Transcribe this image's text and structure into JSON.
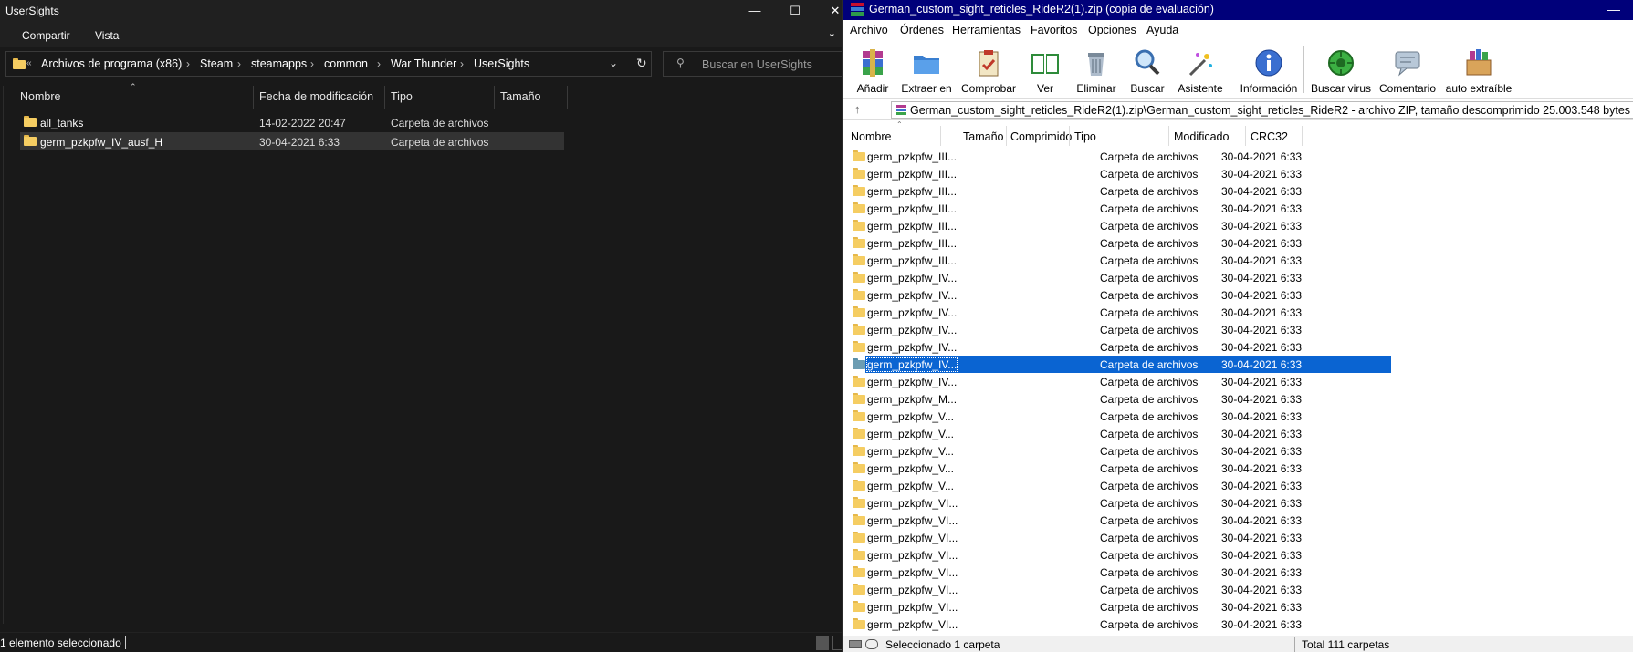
{
  "explorer": {
    "title": "UserSights",
    "window_buttons": [
      "—",
      "☐",
      "✕"
    ],
    "ribbon": {
      "share": "Compartir",
      "view": "Vista"
    },
    "breadcrumb": [
      "Archivos de programa (x86)",
      "Steam",
      "steamapps",
      "common",
      "War Thunder",
      "UserSights"
    ],
    "search_placeholder": "Buscar en UserSights",
    "columns": [
      "Nombre",
      "Fecha de modificación",
      "Tipo",
      "Tamaño"
    ],
    "rows": [
      {
        "name": "all_tanks",
        "date": "14-02-2022 20:47",
        "type": "Carpeta de archivos",
        "selected": false
      },
      {
        "name": "germ_pzkpfw_IV_ausf_H",
        "date": "30-04-2021 6:33",
        "type": "Carpeta de archivos",
        "selected": true
      }
    ],
    "status": "1 elemento seleccionado"
  },
  "winrar": {
    "title": "German_custom_sight_reticles_RideR2(1).zip (copia de evaluación)",
    "menu": [
      "Archivo",
      "Órdenes",
      "Herramientas",
      "Favoritos",
      "Opciones",
      "Ayuda"
    ],
    "toolbar": [
      {
        "label": "Añadir",
        "icon": "add-archive-icon"
      },
      {
        "label": "Extraer en",
        "icon": "extract-folder-icon"
      },
      {
        "label": "Comprobar",
        "icon": "test-clipboard-icon"
      },
      {
        "label": "Ver",
        "icon": "view-book-icon"
      },
      {
        "label": "Eliminar",
        "icon": "delete-trash-icon"
      },
      {
        "label": "Buscar",
        "icon": "find-magnifier-icon"
      },
      {
        "label": "Asistente",
        "icon": "wizard-wand-icon"
      },
      {
        "label": "Información",
        "icon": "info-icon"
      },
      {
        "label": "Buscar virus",
        "icon": "virus-scan-icon"
      },
      {
        "label": "Comentario",
        "icon": "comment-icon"
      },
      {
        "label": "auto extraíble",
        "icon": "sfx-box-icon"
      }
    ],
    "path": "German_custom_sight_reticles_RideR2(1).zip\\German_custom_sight_reticles_RideR2 - archivo ZIP, tamaño descomprimido 25.003.548 bytes",
    "columns": [
      "Nombre",
      "Tamaño",
      "Comprimido",
      "Tipo",
      "Modificado",
      "CRC32"
    ],
    "rows": [
      {
        "name": "germ_pzkpfw_III...",
        "type": "Carpeta de archivos",
        "modified": "30-04-2021 6:33"
      },
      {
        "name": "germ_pzkpfw_III...",
        "type": "Carpeta de archivos",
        "modified": "30-04-2021 6:33"
      },
      {
        "name": "germ_pzkpfw_III...",
        "type": "Carpeta de archivos",
        "modified": "30-04-2021 6:33"
      },
      {
        "name": "germ_pzkpfw_III...",
        "type": "Carpeta de archivos",
        "modified": "30-04-2021 6:33"
      },
      {
        "name": "germ_pzkpfw_III...",
        "type": "Carpeta de archivos",
        "modified": "30-04-2021 6:33"
      },
      {
        "name": "germ_pzkpfw_III...",
        "type": "Carpeta de archivos",
        "modified": "30-04-2021 6:33"
      },
      {
        "name": "germ_pzkpfw_III...",
        "type": "Carpeta de archivos",
        "modified": "30-04-2021 6:33"
      },
      {
        "name": "germ_pzkpfw_IV...",
        "type": "Carpeta de archivos",
        "modified": "30-04-2021 6:33"
      },
      {
        "name": "germ_pzkpfw_IV...",
        "type": "Carpeta de archivos",
        "modified": "30-04-2021 6:33"
      },
      {
        "name": "germ_pzkpfw_IV...",
        "type": "Carpeta de archivos",
        "modified": "30-04-2021 6:33"
      },
      {
        "name": "germ_pzkpfw_IV...",
        "type": "Carpeta de archivos",
        "modified": "30-04-2021 6:33"
      },
      {
        "name": "germ_pzkpfw_IV...",
        "type": "Carpeta de archivos",
        "modified": "30-04-2021 6:33"
      },
      {
        "name": "germ_pzkpfw_IV...",
        "type": "Carpeta de archivos",
        "modified": "30-04-2021 6:33",
        "selected": true
      },
      {
        "name": "germ_pzkpfw_IV...",
        "type": "Carpeta de archivos",
        "modified": "30-04-2021 6:33"
      },
      {
        "name": "germ_pzkpfw_M...",
        "type": "Carpeta de archivos",
        "modified": "30-04-2021 6:33"
      },
      {
        "name": "germ_pzkpfw_V...",
        "type": "Carpeta de archivos",
        "modified": "30-04-2021 6:33"
      },
      {
        "name": "germ_pzkpfw_V...",
        "type": "Carpeta de archivos",
        "modified": "30-04-2021 6:33"
      },
      {
        "name": "germ_pzkpfw_V...",
        "type": "Carpeta de archivos",
        "modified": "30-04-2021 6:33"
      },
      {
        "name": "germ_pzkpfw_V...",
        "type": "Carpeta de archivos",
        "modified": "30-04-2021 6:33"
      },
      {
        "name": "germ_pzkpfw_V...",
        "type": "Carpeta de archivos",
        "modified": "30-04-2021 6:33"
      },
      {
        "name": "germ_pzkpfw_VI...",
        "type": "Carpeta de archivos",
        "modified": "30-04-2021 6:33"
      },
      {
        "name": "germ_pzkpfw_VI...",
        "type": "Carpeta de archivos",
        "modified": "30-04-2021 6:33"
      },
      {
        "name": "germ_pzkpfw_VI...",
        "type": "Carpeta de archivos",
        "modified": "30-04-2021 6:33"
      },
      {
        "name": "germ_pzkpfw_VI...",
        "type": "Carpeta de archivos",
        "modified": "30-04-2021 6:33"
      },
      {
        "name": "germ_pzkpfw_VI...",
        "type": "Carpeta de archivos",
        "modified": "30-04-2021 6:33"
      },
      {
        "name": "germ_pzkpfw_VI...",
        "type": "Carpeta de archivos",
        "modified": "30-04-2021 6:33"
      },
      {
        "name": "germ_pzkpfw_VI...",
        "type": "Carpeta de archivos",
        "modified": "30-04-2021 6:33"
      },
      {
        "name": "germ_pzkpfw_VI...",
        "type": "Carpeta de archivos",
        "modified": "30-04-2021 6:33"
      }
    ],
    "status_left": "Seleccionado 1 carpeta",
    "status_right": "Total 111 carpetas",
    "colors": {
      "title_bg": "#00007a",
      "selection": "#0a64d2"
    }
  }
}
